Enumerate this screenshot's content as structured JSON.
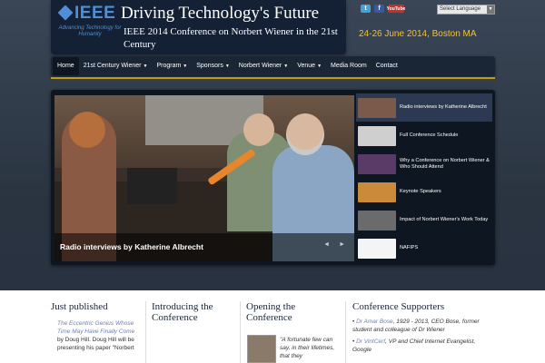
{
  "header": {
    "logo_word": "IEEE",
    "logo_tagline": "Advancing Technology for Humanity",
    "title": "Driving Technology's Future",
    "subtitle": "IEEE 2014 Conference on Norbert Wiener in the 21st Century",
    "date_location": "24-26 June 2014, Boston MA",
    "select_language": "Select Language"
  },
  "social": {
    "twitter": "t",
    "facebook": "f",
    "youtube": "YouTube"
  },
  "nav": {
    "items": [
      {
        "label": "Home",
        "active": true,
        "dropdown": false
      },
      {
        "label": "21st Century Wiener",
        "active": false,
        "dropdown": true
      },
      {
        "label": "Program",
        "active": false,
        "dropdown": true
      },
      {
        "label": "Sponsors",
        "active": false,
        "dropdown": true
      },
      {
        "label": "Norbert Wiener",
        "active": false,
        "dropdown": true
      },
      {
        "label": "Venue",
        "active": false,
        "dropdown": true
      },
      {
        "label": "Media Room",
        "active": false,
        "dropdown": false
      },
      {
        "label": "Contact",
        "active": false,
        "dropdown": false
      }
    ],
    "caret": "▼"
  },
  "slider": {
    "caption": "Radio interviews by Katherine Albrecht",
    "prev": "◄",
    "next": "►",
    "thumbs": [
      {
        "label": "Radio interviews by Katherine Albrecht",
        "color": "#7a5a4a"
      },
      {
        "label": "Full Conference Schedule",
        "color": "#cfcfcf"
      },
      {
        "label": "Why a Conference on Norbert Wiener & Who Should Attend",
        "color": "#5a3a66"
      },
      {
        "label": "Keynote Speakers",
        "color": "#c98a3a"
      },
      {
        "label": "Impact of Norbert Wiener's Work Today",
        "color": "#6b6b6b"
      },
      {
        "label": "NAFIPS",
        "color": "#f4f4f4"
      }
    ]
  },
  "sections": {
    "just_published": {
      "heading": "Just published",
      "link_text": "The Eccentric Genius Whose Time May Have Finally Come",
      "body": "by Doug Hill. Doug Hill will be presenting his paper \"Norbert"
    },
    "introducing": {
      "heading": "Introducing the Conference"
    },
    "opening": {
      "heading": "Opening the Conference",
      "quote": "\"A fortunate few can say, in their lifetimes, that they"
    },
    "supporters": {
      "heading": "Conference Supporters",
      "items": [
        {
          "name": "Dr Amar Bose",
          "detail": ", 1929 - 2013, CEO Bose, former student and colleague of Dr Wiener"
        },
        {
          "name": "Dr VintCerf",
          "detail": ", VP and Chief Internet Evangelist, Google"
        }
      ]
    }
  },
  "colors": {
    "accent_yellow": "#f1c232",
    "ieee_blue": "#4f8fd6",
    "header_bg": "#142033",
    "nav_bg": "#1a2535",
    "content_bg": "#ffffff",
    "link_blue": "#6b7fb3"
  }
}
